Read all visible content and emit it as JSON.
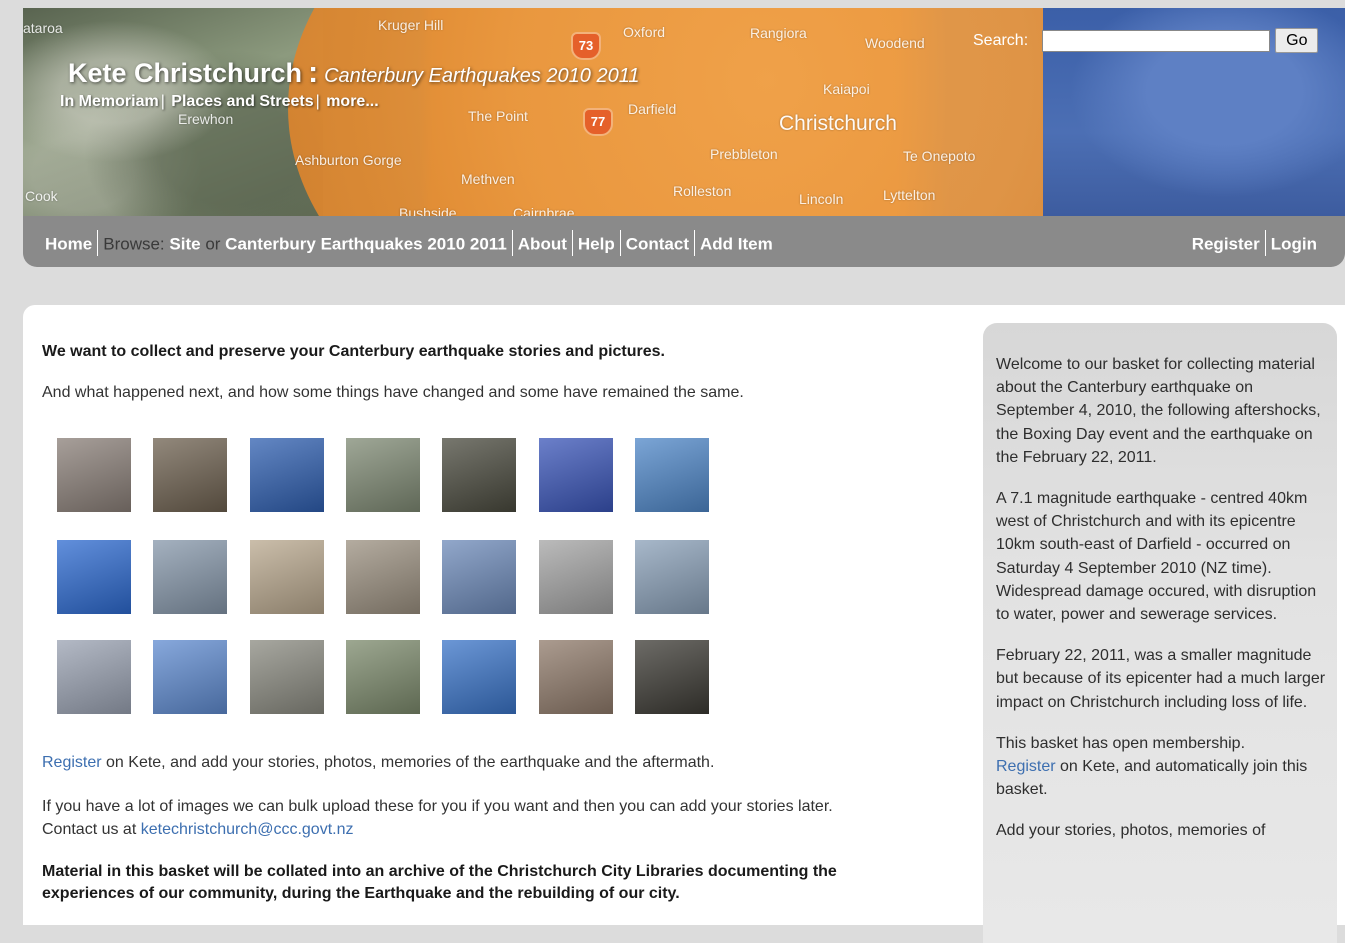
{
  "header": {
    "site_name": "Kete Christchurch",
    "separator": ":",
    "basket_name": "Canterbury Earthquakes 2010 2011",
    "basket_links": [
      "In Memoriam",
      "Places and Streets",
      "more..."
    ],
    "search_label": "Search:",
    "search_value": "",
    "search_button": "Go",
    "map_labels": {
      "kruger_hill": "Kruger Hill",
      "oxford": "Oxford",
      "rangiora": "Rangiora",
      "woodend": "Woodend",
      "kaiapoi": "Kaiapoi",
      "darfield": "Darfield",
      "the_point": "The Point",
      "christchurch": "Christchurch",
      "prebbleton": "Prebbleton",
      "te_onepoto": "Te Onepoto",
      "ashburton_gorge": "Ashburton Gorge",
      "methven": "Methven",
      "rolleston": "Rolleston",
      "lincoln": "Lincoln",
      "lyttelton": "Lyttelton",
      "erewhon": "Erewhon",
      "mataroa": "ataroa",
      "cook": "Cook",
      "bushside": "Bushside",
      "cairnbrae": "Cairnbrae",
      "road_73": "73",
      "road_77": "77"
    }
  },
  "nav": {
    "home": "Home",
    "browse_label": "Browse:",
    "site": "Site",
    "or_label": "or",
    "basket": "Canterbury Earthquakes 2010 2011",
    "about": "About",
    "help": "Help",
    "contact": "Contact",
    "add_item": "Add Item",
    "register": "Register",
    "login": "Login"
  },
  "main": {
    "intro_bold": "We want to collect and preserve your Canterbury earthquake stories and pictures.",
    "intro_2": "And what happened next, and how some things have changed and some have remained the same.",
    "register_link": "Register",
    "register_text": " on Kete, and add your stories, photos, memories of the earthquake and the aftermath.",
    "bulk_text": "If you have a lot of images we can bulk upload these for you if you want and then you can add your stories later.",
    "contact_prefix": "Contact us at ",
    "contact_email": "ketechristchurch@ccc.govt.nz",
    "archive_bold": "Material in this basket will be collated into an archive of the Christchurch City Libraries documenting the experiences of our community, during the Earthquake and the rebuilding of our city."
  },
  "gallery_colors": [
    [
      "#8a7f78",
      "#6e6150",
      "#2f5fb0",
      "#7f8a74",
      "#4a4a3e",
      "#3a55b8",
      "#4f87c8"
    ],
    [
      "#2d6ad0",
      "#8697aa",
      "#b9a88e",
      "#9b9080",
      "#6d8ab9",
      "#a4a4a4",
      "#8aa0b8"
    ],
    [
      "#9aa2b2",
      "#5f8bd0",
      "#8a8a80",
      "#7c8a6c",
      "#3a74c8",
      "#8f7a6a",
      "#3c3a34"
    ]
  ],
  "sidebar": {
    "p1": "Welcome to our basket for collecting material about the Canterbury earthquake on September 4, 2010, the following aftershocks, the Boxing Day event  and the earthquake on the February 22, 2011.",
    "p2": "A 7.1 magnitude earthquake - centred 40km west of Christchurch and with its epicentre 10km south-east of Darfield - occurred on Saturday 4 September 2010 (NZ time). Widespread damage occured, with disruption to water, power and sewerage services.",
    "p3": "February 22, 2011, was a smaller magnitude but because of its epicenter had a much larger impact on Christchurch including loss of life.",
    "p4": "This basket has open membership.",
    "p5_link": "Register",
    "p5_text": " on Kete, and automatically join this basket.",
    "p6": "Add your stories, photos, memories of"
  }
}
